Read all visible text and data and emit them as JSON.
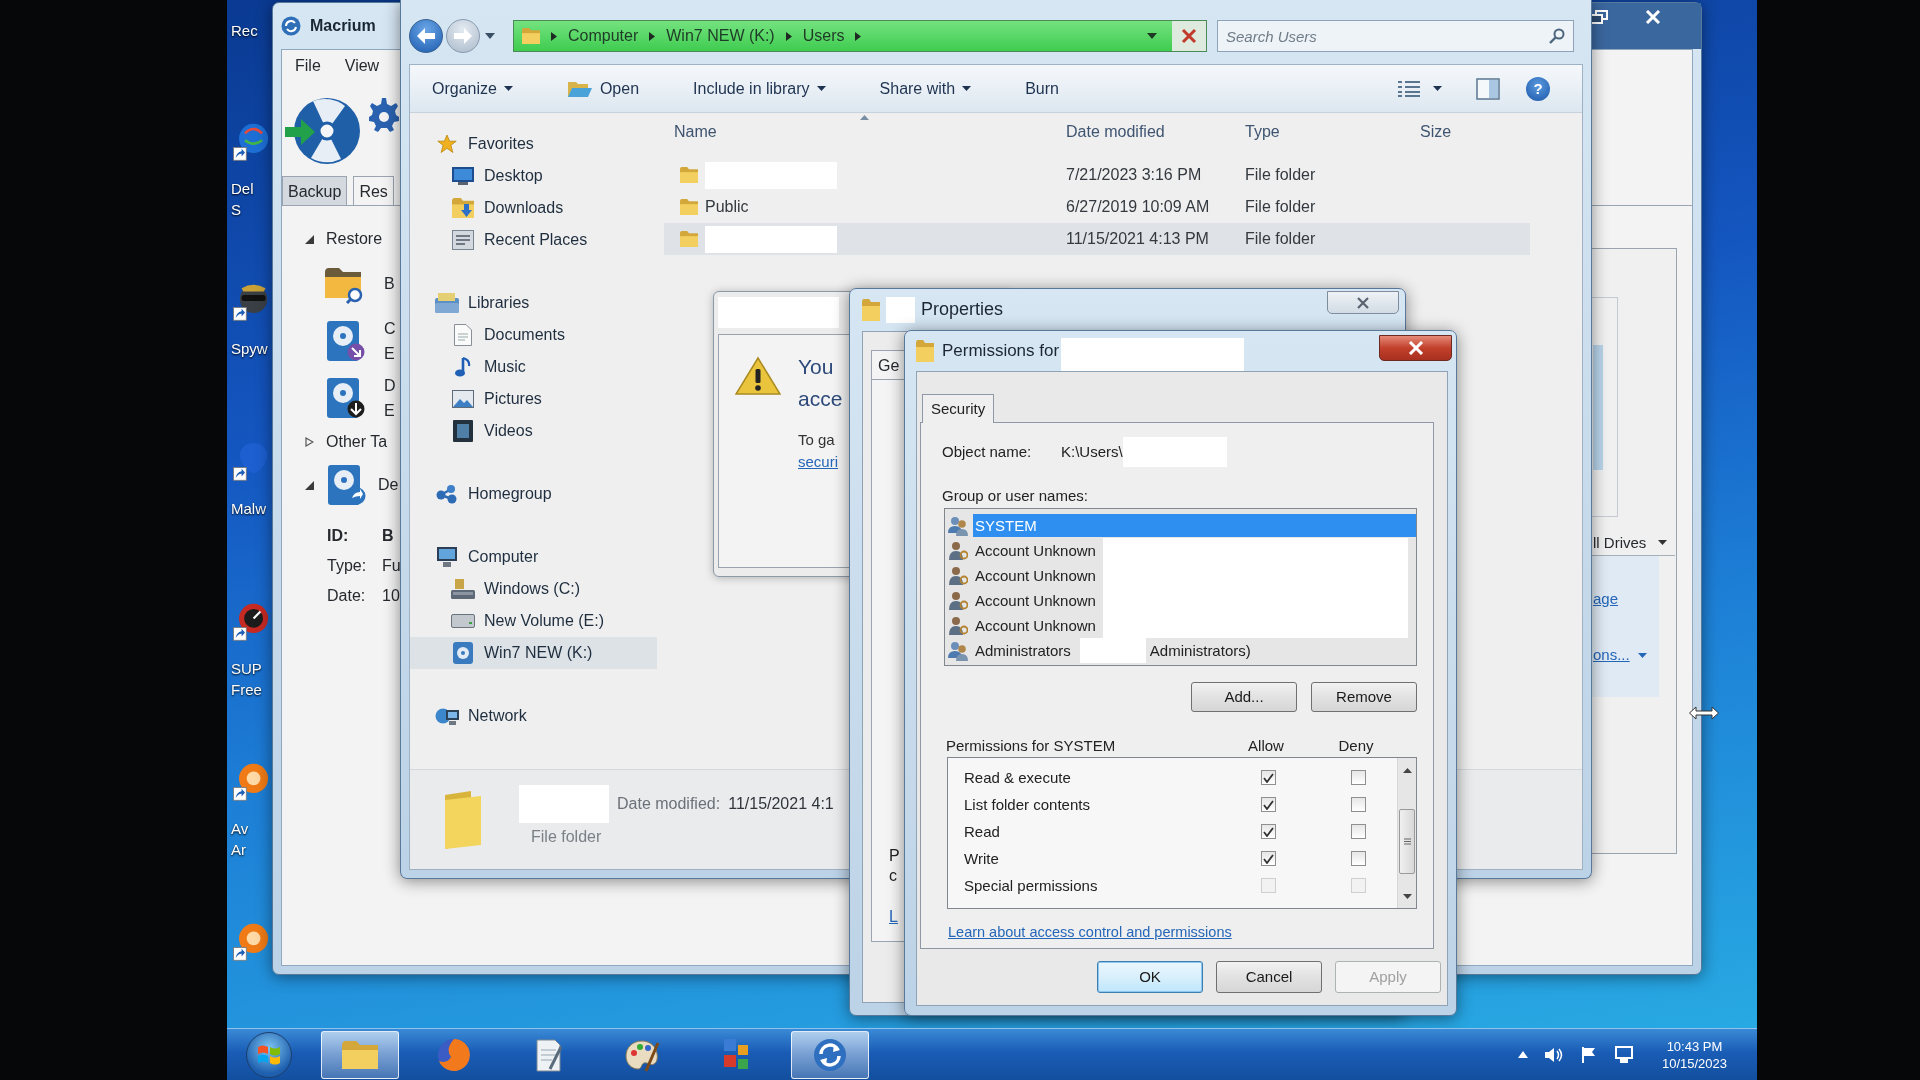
{
  "desktop": {
    "icons": [
      {
        "kind": "cut",
        "lines": [
          "Rec"
        ]
      },
      {
        "kind": "dell",
        "lines": [
          "Del",
          "S"
        ]
      },
      {
        "kind": "spy",
        "lines": [
          "Spyw"
        ]
      },
      {
        "kind": "shield",
        "lines": [
          "Malw"
        ]
      },
      {
        "kind": "gauge",
        "lines": [
          "SUP",
          "Free"
        ]
      },
      {
        "kind": "orange",
        "lines": [
          "Av",
          "Ar"
        ]
      },
      {
        "kind": "orange"
      }
    ]
  },
  "macrium": {
    "title": "Macrium",
    "menu": [
      "File",
      "View"
    ],
    "tabs": [
      {
        "label": "Backup",
        "selected": false
      },
      {
        "label": "Res",
        "selected": true
      }
    ],
    "tree": [
      {
        "label": "Restore",
        "kind": "heading",
        "expanded": true,
        "children": [
          {
            "kind": "browse",
            "lines": [
              "B"
            ]
          },
          {
            "kind": "image",
            "lines": [
              "C",
              "E"
            ]
          },
          {
            "kind": "download",
            "lines": [
              "D",
              "E"
            ]
          }
        ]
      },
      {
        "label": "Other Ta",
        "kind": "heading",
        "expanded": false
      },
      {
        "label": "De",
        "kind": "image",
        "expanded": true
      }
    ],
    "details": [
      {
        "label": "ID:",
        "value": "B",
        "strong": true
      },
      {
        "label": "Type:",
        "value": "Fu",
        "strong": false
      },
      {
        "label": "Date:",
        "value": "10",
        "strong": false
      }
    ],
    "side": {
      "dropdown": "ll Drives",
      "links": [
        {
          "label": "age",
          "menu": false
        },
        {
          "label": "ons...",
          "menu": true
        }
      ]
    }
  },
  "explorer": {
    "address": [
      "Computer",
      "Win7 NEW (K:)",
      "Users"
    ],
    "search": {
      "placeholder": "Search Users"
    },
    "toolbar": [
      {
        "label": "Organize",
        "kind": "menu"
      },
      {
        "label": "Open",
        "kind": "open"
      },
      {
        "label": "Include in library",
        "kind": "menu"
      },
      {
        "label": "Share with",
        "kind": "menu"
      },
      {
        "label": "Burn",
        "kind": "plain"
      }
    ],
    "help": "?",
    "nav": [
      {
        "label": "Favorites",
        "kind": "star",
        "selected": false,
        "children": [
          {
            "label": "Desktop",
            "kind": "desktop",
            "selected": false
          },
          {
            "label": "Downloads",
            "kind": "downloads",
            "selected": false
          },
          {
            "label": "Recent Places",
            "kind": "recent",
            "selected": false
          }
        ]
      },
      {
        "label": "Libraries",
        "kind": "libraries",
        "selected": false,
        "children": [
          {
            "label": "Documents",
            "kind": "documents",
            "selected": false
          },
          {
            "label": "Music",
            "kind": "music",
            "selected": false
          },
          {
            "label": "Pictures",
            "kind": "pictures",
            "selected": false
          },
          {
            "label": "Videos",
            "kind": "videos",
            "selected": false
          }
        ]
      },
      {
        "label": "Homegroup",
        "kind": "homegroup",
        "selected": false
      },
      {
        "label": "Computer",
        "kind": "computer",
        "selected": false,
        "children": [
          {
            "label": "Windows (C:)",
            "kind": "system",
            "selected": false
          },
          {
            "label": "New Volume (E:)",
            "kind": "volume",
            "selected": false
          },
          {
            "label": "Win7 NEW (K:)",
            "kind": "usb",
            "selected": true
          }
        ]
      },
      {
        "label": "Network",
        "kind": "network",
        "selected": false
      }
    ],
    "columns": [
      {
        "label": "Name",
        "sorted": true
      },
      {
        "label": "Date modified",
        "sorted": false
      },
      {
        "label": "Type",
        "sorted": false
      },
      {
        "label": "Size",
        "sorted": false
      }
    ],
    "rows": [
      {
        "redacted": true,
        "date": "7/21/2023 3:16 PM",
        "type": "File folder",
        "selected": false
      },
      {
        "name": "Public",
        "redacted": false,
        "date": "6/27/2019 10:09 AM",
        "type": "File folder",
        "selected": false
      },
      {
        "redacted": true,
        "date": "11/15/2021 4:13 PM",
        "type": "File folder",
        "selected": true
      }
    ],
    "details_pane": {
      "redacted": true,
      "date_label": "Date modified:",
      "date": "11/15/2021 4:1",
      "type": "File folder"
    }
  },
  "denied_dialog": {
    "title_redacted": true,
    "message": [
      "You",
      "acce"
    ],
    "hint": "To ga",
    "link": "securi"
  },
  "properties": {
    "title_redacted": true,
    "title": "Properties",
    "tabs": [
      "Ge"
    ],
    "fragments": [
      {
        "text": "P",
        "kind": "text"
      },
      {
        "text": "c",
        "kind": "text"
      },
      {
        "text": "L",
        "kind": "link"
      }
    ]
  },
  "permissions": {
    "title": "Permissions for",
    "title_redacted": true,
    "tabs": [
      {
        "label": "Security",
        "selected": true
      }
    ],
    "object_label": "Object name:",
    "object_value": "K:\\Users\\",
    "object_redacted": true,
    "groups_label": "Group or user names:",
    "principals": [
      {
        "name": "SYSTEM",
        "kind": "group",
        "selected": true,
        "redacted": false
      },
      {
        "name": "Account Unknown",
        "kind": "unknown",
        "selected": false,
        "redacted": true
      },
      {
        "name": "Account Unknown",
        "kind": "unknown",
        "selected": false,
        "redacted": true
      },
      {
        "name": "Account Unknown",
        "kind": "unknown",
        "selected": false,
        "redacted": true
      },
      {
        "name": "Account Unknown",
        "kind": "unknown",
        "selected": false,
        "redacted": true
      },
      {
        "name": "Administrators",
        "suffix": "Administrators)",
        "kind": "group",
        "selected": false,
        "redacted": true
      }
    ],
    "buttons": [
      "Add...",
      "Remove"
    ],
    "perms_label": "Permissions for SYSTEM",
    "perm_columns": [
      "Allow",
      "Deny"
    ],
    "perms": [
      {
        "name": "Read & execute",
        "allow": true,
        "deny": false,
        "disabled": false
      },
      {
        "name": "List folder contents",
        "allow": true,
        "deny": false,
        "disabled": false
      },
      {
        "name": "Read",
        "allow": true,
        "deny": false,
        "disabled": false
      },
      {
        "name": "Write",
        "allow": true,
        "deny": false,
        "disabled": false
      },
      {
        "name": "Special permissions",
        "allow": false,
        "deny": false,
        "disabled": true
      }
    ],
    "link": "Learn about access control and permissions",
    "footer": [
      {
        "label": "OK",
        "default": true,
        "disabled": false
      },
      {
        "label": "Cancel",
        "default": false,
        "disabled": false
      },
      {
        "label": "Apply",
        "default": false,
        "disabled": true
      }
    ]
  },
  "taskbar": {
    "items": [
      {
        "kind": "folder",
        "running": true
      },
      {
        "kind": "browser",
        "running": false
      },
      {
        "kind": "notepad",
        "running": false
      },
      {
        "kind": "paint",
        "running": false
      },
      {
        "kind": "panel",
        "running": false
      },
      {
        "kind": "restore",
        "running": true
      }
    ],
    "time": "10:43 PM",
    "date": "10/15/2023"
  }
}
